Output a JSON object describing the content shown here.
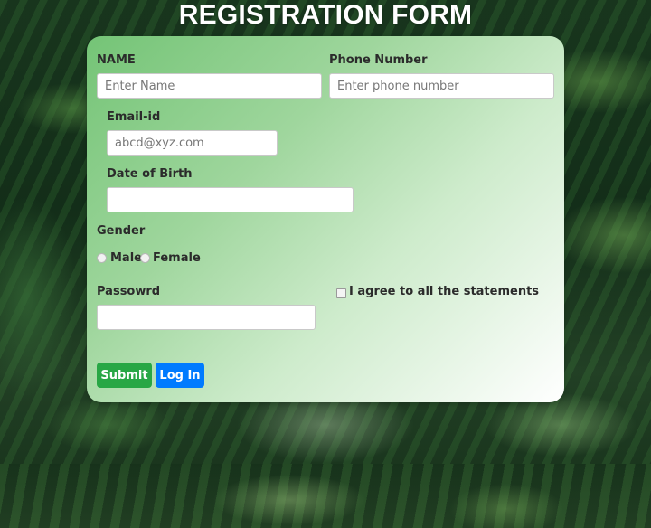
{
  "page": {
    "title": "REGISTRATION FORM"
  },
  "form": {
    "name": {
      "label": "NAME",
      "placeholder": "Enter Name"
    },
    "phone": {
      "label": "Phone Number",
      "placeholder": "Enter phone number"
    },
    "email": {
      "label": "Email-id",
      "placeholder": "abcd@xyz.com"
    },
    "dob": {
      "label": "Date of Birth",
      "placeholder": ""
    },
    "gender": {
      "label": "Gender",
      "options": [
        {
          "label": "Male"
        },
        {
          "label": "Female"
        }
      ]
    },
    "password": {
      "label": "Passowrd",
      "placeholder": ""
    },
    "agree": {
      "label": "I agree to all the statements",
      "checked": false
    },
    "buttons": {
      "submit": "Submit",
      "login": "Log In"
    }
  },
  "colors": {
    "submit": "#28a745",
    "login": "#007bff",
    "card_start": "#74c476",
    "card_end": "#ffffff"
  }
}
